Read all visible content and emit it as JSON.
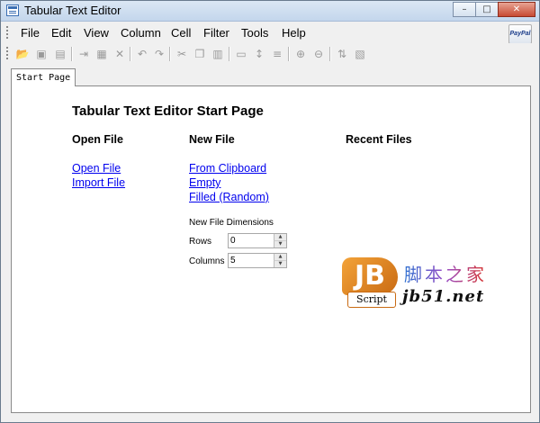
{
  "window": {
    "title": "Tabular Text Editor"
  },
  "titlebar": {
    "minimize": "–",
    "maximize": "□",
    "close": "✕"
  },
  "menu": [
    "File",
    "Edit",
    "View",
    "Column",
    "Cell",
    "Filter",
    "Tools",
    "Help"
  ],
  "paypal_label": "PayPal",
  "toolbar_icons": [
    "open-icon",
    "save-icon",
    "save-as-icon",
    "import-icon",
    "export-icon",
    "delete-icon",
    "undo-icon",
    "redo-icon",
    "cut-icon",
    "copy-icon",
    "paste-icon",
    "merge-icon",
    "split-icon",
    "justify-icon",
    "zoom-in-icon",
    "zoom-out-icon",
    "sort-icon",
    "view-icon"
  ],
  "tab": {
    "label": "Start Page"
  },
  "start_page": {
    "heading": "Tabular Text Editor Start Page",
    "open_file": {
      "title": "Open File",
      "links": [
        "Open File",
        "Import File"
      ]
    },
    "new_file": {
      "title": "New File",
      "links": [
        "From Clipboard",
        "Empty",
        "Filled (Random)"
      ]
    },
    "recent_files": {
      "title": "Recent Files"
    },
    "dimensions": {
      "label": "New File Dimensions",
      "rows_label": "Rows",
      "rows_value": "0",
      "columns_label": "Columns",
      "columns_value": "5"
    }
  },
  "watermark": {
    "logo": "JB",
    "logo_sub": "Script",
    "cn_text": "脚本之家",
    "url": "jb51.net"
  },
  "colors": {
    "link": "#0000ee",
    "titlebar": "#c3d6ec",
    "accent": "#c96a12"
  }
}
